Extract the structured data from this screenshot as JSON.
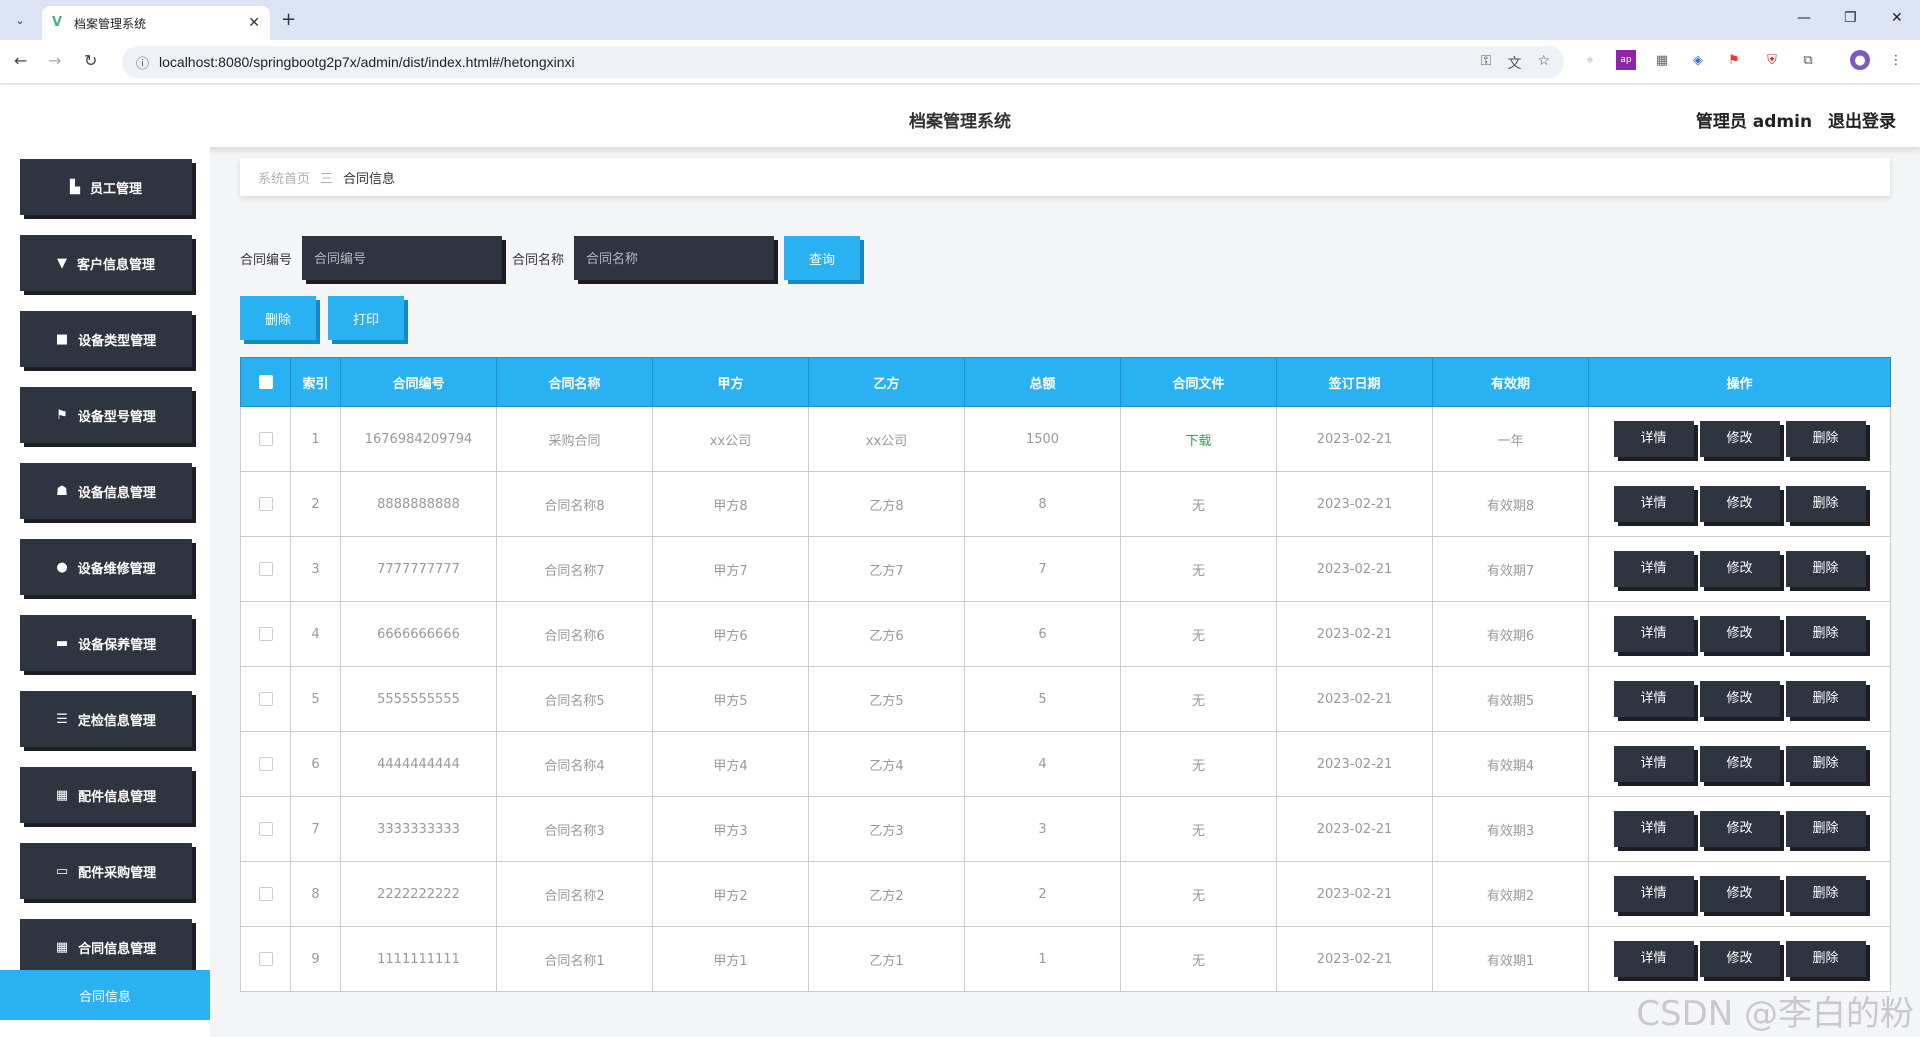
{
  "browser": {
    "tab_title": "档案管理系统",
    "url": "localhost:8080/springbootg2p7x/admin/dist/index.html#/hetongxinxi",
    "new_tab": "+",
    "close_tab": "✕",
    "minimize": "—",
    "restore": "❐",
    "close_window": "✕"
  },
  "header": {
    "title": "档案管理系统",
    "user_label": "管理员 admin",
    "logout_label": "退出登录"
  },
  "sidebar": {
    "items": [
      {
        "label": "员工管理",
        "icon": "building-icon"
      },
      {
        "label": "客户信息管理",
        "icon": "flag-stand-icon"
      },
      {
        "label": "设备类型管理",
        "icon": "device-icon"
      },
      {
        "label": "设备型号管理",
        "icon": "flag-icon"
      },
      {
        "label": "设备信息管理",
        "icon": "thumb-icon"
      },
      {
        "label": "设备维修管理",
        "icon": "user-icon"
      },
      {
        "label": "设备保养管理",
        "icon": "ticket-icon"
      },
      {
        "label": "定检信息管理",
        "icon": "list-icon"
      },
      {
        "label": "配件信息管理",
        "icon": "grid-icon"
      },
      {
        "label": "配件采购管理",
        "icon": "monitor-icon"
      },
      {
        "label": "合同信息管理",
        "icon": "grid-icon"
      }
    ],
    "active_sub": "合同信息"
  },
  "breadcrumb": {
    "home": "系统首页",
    "sep": "三",
    "current": "合同信息"
  },
  "search": {
    "no_label": "合同编号",
    "no_placeholder": "合同编号",
    "name_label": "合同名称",
    "name_placeholder": "合同名称",
    "query_label": "查询"
  },
  "actions": {
    "delete_label": "删除",
    "print_label": "打印"
  },
  "table": {
    "columns": [
      "索引",
      "合同编号",
      "合同名称",
      "甲方",
      "乙方",
      "总额",
      "合同文件",
      "签订日期",
      "有效期",
      "操作"
    ],
    "rows": [
      [
        "1",
        "1676984209794",
        "采购合同",
        "xx公司",
        "xx公司",
        "1500",
        "下载",
        "2023-02-21",
        "一年"
      ],
      [
        "2",
        "8888888888",
        "合同名称8",
        "甲方8",
        "乙方8",
        "8",
        "无",
        "2023-02-21",
        "有效期8"
      ],
      [
        "3",
        "7777777777",
        "合同名称7",
        "甲方7",
        "乙方7",
        "7",
        "无",
        "2023-02-21",
        "有效期7"
      ],
      [
        "4",
        "6666666666",
        "合同名称6",
        "甲方6",
        "乙方6",
        "6",
        "无",
        "2023-02-21",
        "有效期6"
      ],
      [
        "5",
        "5555555555",
        "合同名称5",
        "甲方5",
        "乙方5",
        "5",
        "无",
        "2023-02-21",
        "有效期5"
      ],
      [
        "6",
        "4444444444",
        "合同名称4",
        "甲方4",
        "乙方4",
        "4",
        "无",
        "2023-02-21",
        "有效期4"
      ],
      [
        "7",
        "3333333333",
        "合同名称3",
        "甲方3",
        "乙方3",
        "3",
        "无",
        "2023-02-21",
        "有效期3"
      ],
      [
        "8",
        "2222222222",
        "合同名称2",
        "甲方2",
        "乙方2",
        "2",
        "无",
        "2023-02-21",
        "有效期2"
      ],
      [
        "9",
        "1111111111",
        "合同名称1",
        "甲方1",
        "乙方1",
        "1",
        "无",
        "2023-02-21",
        "有效期1"
      ]
    ],
    "row_actions": [
      "详情",
      "修改",
      "删除"
    ]
  },
  "watermark": "CSDN @李白的粉",
  "colors": {
    "accent": "#2ab1f2",
    "dark": "#2f3441",
    "download": "#2aa84a"
  }
}
